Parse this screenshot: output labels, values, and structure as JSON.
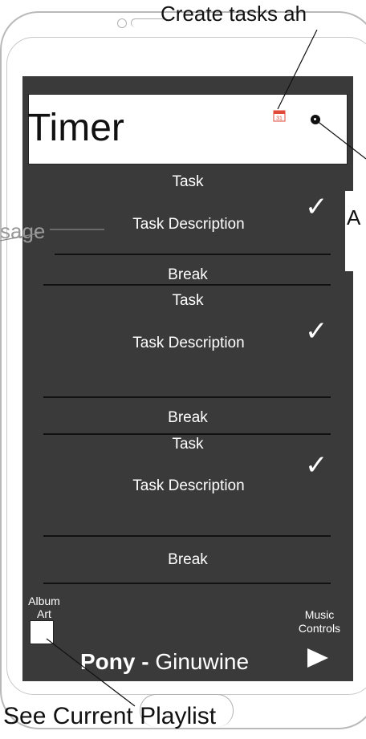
{
  "app": {
    "title": "Timer",
    "calendar_day": "31"
  },
  "tasks": [
    {
      "label": "Task",
      "description": "Task Description",
      "break_label": "Break"
    },
    {
      "label": "Task",
      "description": "Task Description",
      "break_label": "Break"
    },
    {
      "label": "Task",
      "description": "Task Description",
      "break_label": "Break"
    }
  ],
  "player": {
    "album_art_label": "Album Art",
    "album_label_line1": "Album",
    "album_label_line2": "Art",
    "music_controls_line1": "Music",
    "music_controls_line2": "Controls",
    "song_title": "Pony - ",
    "artist": "Ginuwine"
  },
  "annotations": {
    "create_tasks": "Create tasks ah",
    "add_partial": "A",
    "message_partial": "sage",
    "see_playlist": "See Current Playlist"
  },
  "colors": {
    "screen_bg": "#3a3a3a",
    "text_on_screen": "#ffffff",
    "calendar_red": "#e04a3a"
  }
}
